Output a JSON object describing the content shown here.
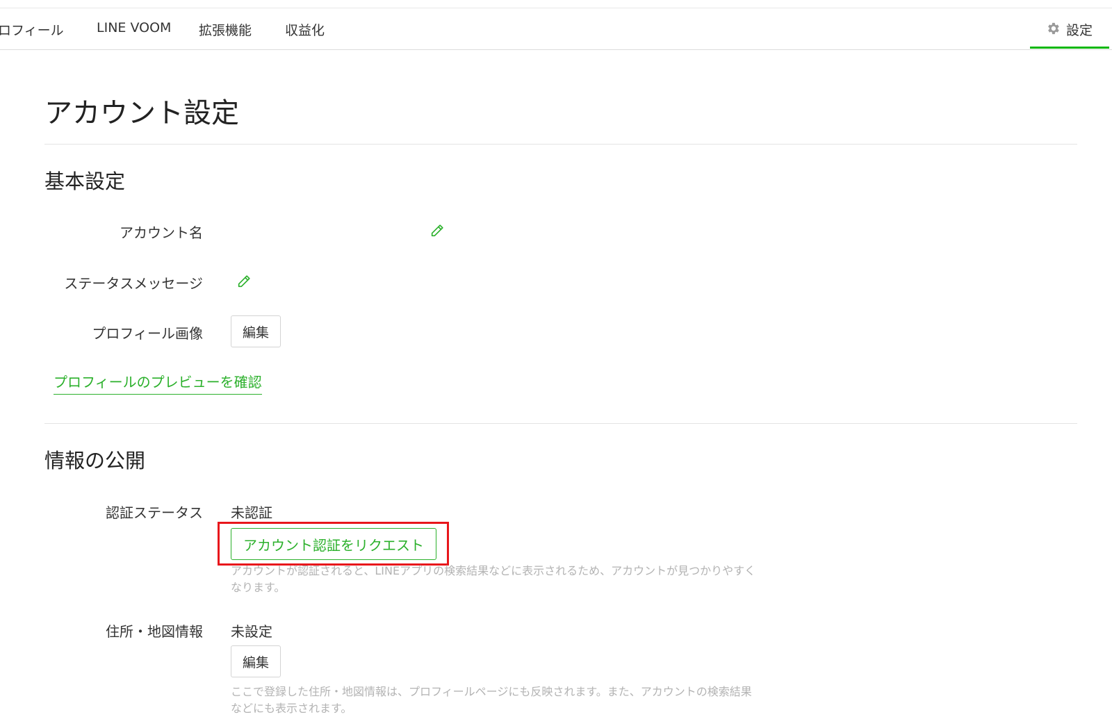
{
  "nav": {
    "items": [
      "プロフィール",
      "LINE VOOM",
      "拡張機能",
      "収益化"
    ],
    "settings_label": "設定",
    "accent_color": "#06b706"
  },
  "page": {
    "title": "アカウント設定"
  },
  "basic": {
    "title": "基本設定",
    "account_name_label": "アカウント名",
    "status_message_label": "ステータスメッセージ",
    "profile_image_label": "プロフィール画像",
    "edit_label": "編集",
    "preview_link": "プロフィールのプレビューを確認"
  },
  "info": {
    "title": "情報の公開",
    "verification_label": "認証ステータス",
    "verification_value": "未認証",
    "verification_button": "アカウント認証をリクエスト",
    "verification_help": "アカウントが認証されると、LINEアプリの検索結果などに表示されるため、アカウントが見つかりやすくなります。",
    "address_label": "住所・地図情報",
    "address_value": "未設定",
    "address_edit_label": "編集",
    "address_help": "ここで登録した住所・地図情報は、プロフィールページにも反映されます。また、アカウントの検索結果などにも表示されます。"
  },
  "icons": {
    "gear": "gear-icon",
    "pencil": "pencil-icon"
  },
  "colors": {
    "link_green": "#2bb02b",
    "highlight_red": "#e8161b"
  }
}
